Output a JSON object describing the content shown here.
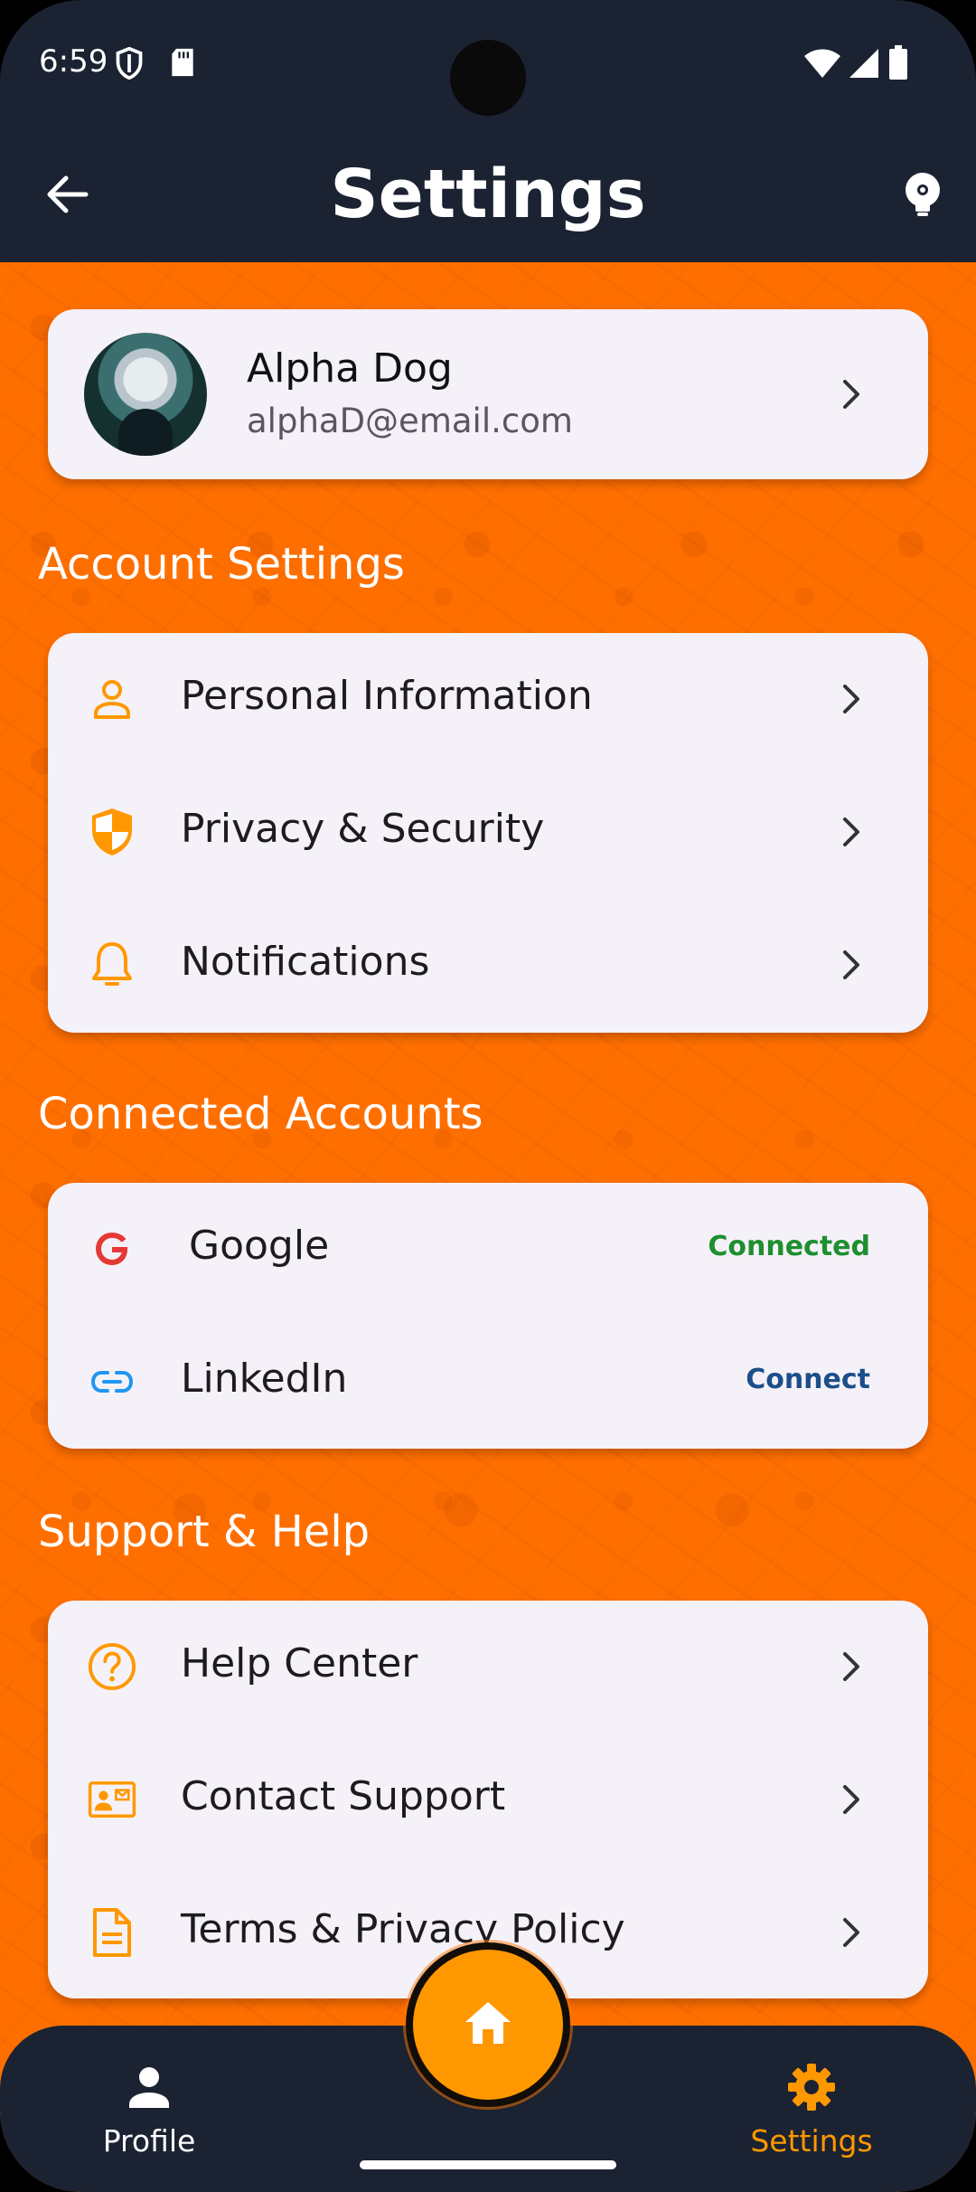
{
  "status_bar": {
    "time": "6:59",
    "icons": [
      "shield-icon",
      "sd-card-icon",
      "wifi-icon",
      "signal-icon",
      "battery-icon"
    ]
  },
  "app_bar": {
    "title": "Settings",
    "back_icon": "arrow-left-icon",
    "theme_icon": "lightbulb-gear-icon"
  },
  "profile": {
    "name": "Alpha Dog",
    "email": "alphaD@email.com"
  },
  "sections": {
    "account": {
      "title": "Account Settings",
      "items": [
        {
          "label": "Personal Information",
          "icon": "person-icon"
        },
        {
          "label": "Privacy & Security",
          "icon": "shield-icon"
        },
        {
          "label": "Notifications",
          "icon": "bell-icon"
        }
      ]
    },
    "connected": {
      "title": "Connected Accounts",
      "items": [
        {
          "label": "Google",
          "icon": "google-icon",
          "status": "Connected"
        },
        {
          "label": "LinkedIn",
          "icon": "link-icon",
          "status": "Connect"
        }
      ]
    },
    "support": {
      "title": "Support & Help",
      "items": [
        {
          "label": "Help Center",
          "icon": "help-circle-icon"
        },
        {
          "label": "Contact Support",
          "icon": "contact-card-icon"
        },
        {
          "label": "Terms & Privacy Policy",
          "icon": "document-icon"
        }
      ]
    }
  },
  "bottom_nav": {
    "profile_label": "Profile",
    "settings_label": "Settings",
    "home_icon": "home-icon"
  },
  "colors": {
    "background": "#ff6f00",
    "accent": "#ff9800",
    "bar": "#1b2232",
    "card": "#f5f1f8",
    "connected": "#1e8f2f",
    "connect": "#1b4f8a"
  }
}
